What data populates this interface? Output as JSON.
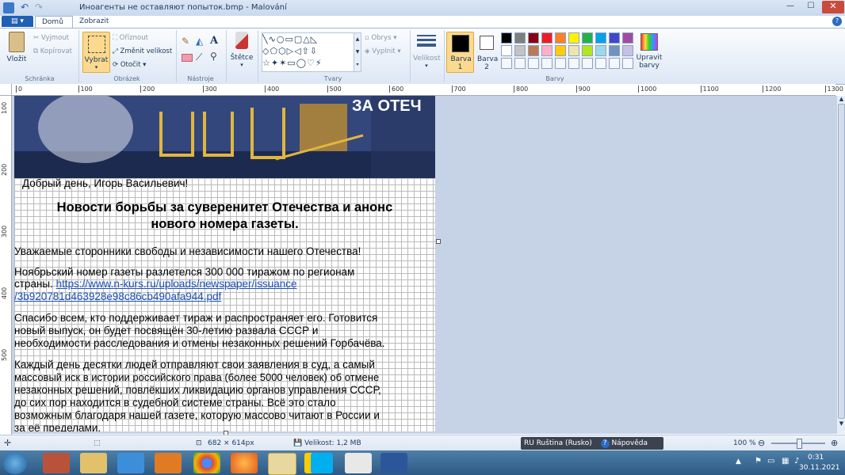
{
  "window": {
    "title": "Иноагенты не оставляют попыток.bmp - Malování"
  },
  "tabs": {
    "home": "Domů",
    "view": "Zobrazit"
  },
  "ribbon": {
    "clipboard": {
      "paste": "Vložit",
      "cut": "Vyjmout",
      "copy": "Kopírovat",
      "group": "Schránka"
    },
    "image": {
      "select": "Vybrat",
      "crop": "Oříznout",
      "resize": "Změnit velikost",
      "rotate": "Otočit",
      "group": "Obrázek"
    },
    "tools": {
      "group": "Nástroje"
    },
    "brushes": {
      "label": "Štětce"
    },
    "shapes": {
      "outline": "Obrys",
      "fill": "Vyplnit",
      "group": "Tvary"
    },
    "size": {
      "label": "Velikost"
    },
    "colors": {
      "color1": "Barva 1",
      "color2": "Barva 2",
      "edit": "Upravit barvy",
      "group": "Barvy",
      "palette": [
        "#000000",
        "#7f7f7f",
        "#880015",
        "#ed1c24",
        "#ff7f27",
        "#fff200",
        "#22b14c",
        "#00a2e8",
        "#3f48cc",
        "#a349a4",
        "#ffffff",
        "#c3c3c3",
        "#b97a57",
        "#ffaec9",
        "#ffc90e",
        "#efe4b0",
        "#b5e61d",
        "#99d9ea",
        "#7092be",
        "#c8bfe7"
      ]
    }
  },
  "ruler_top": [
    "0",
    "100",
    "200",
    "300",
    "400",
    "500",
    "600",
    "700",
    "800",
    "900",
    "1000",
    "1100",
    "1200",
    "1300"
  ],
  "ruler_left": [
    "100",
    "200",
    "300",
    "400",
    "500"
  ],
  "content": {
    "banner_text": "ЗА ОТЕЧ",
    "greeting": "Добрый день, Игорь Васильевич!",
    "headline1": "Новости борьбы за суверенитет Отечества и анонс",
    "headline2": "нового номера газеты.",
    "p1": "Уважаемые сторонники свободы и независимости нашего Отечества!",
    "p2a": "Ноябрьский номер газеты разлетелся 300 000 тиражом по регионам",
    "p2b": "страны.",
    "p2link1": "https://www.n-kurs.ru/uploads/newspaper/issuance",
    "p2link2": "/3b920781d463928e98c86cb490afa944.pdf",
    "p3a": "Спасибо всем, кто поддерживает тираж и распространяет его. Готовится",
    "p3b": "новый выпуск, он будет посвящён 30-летию развала СССР и",
    "p3c": "необходимости расследования и отмены незаконных решений Горбачёва.",
    "p4a": "Каждый день десятки людей отправляют свои заявления в суд, а самый",
    "p4b": "массовый иск в истории российского права (более 5000 человек) об отмене",
    "p4c": "незаконных решений, повлёкших ликвидацию органов управления СССР,",
    "p4d": "до сих пор находится в судебной системе страны. Всё это стало",
    "p4e": "возможным благодаря нашей газете, которую массово читают в России и",
    "p4f": "за её пределами."
  },
  "status": {
    "dimensions": "682 × 614px",
    "size": "Velikost: 1,2 MB",
    "zoom": "100 %",
    "lang": "RU Ruština (Rusko)",
    "help": "Nápověda"
  },
  "taskbar": {
    "time": "0:31",
    "date": "30.11.2021"
  }
}
